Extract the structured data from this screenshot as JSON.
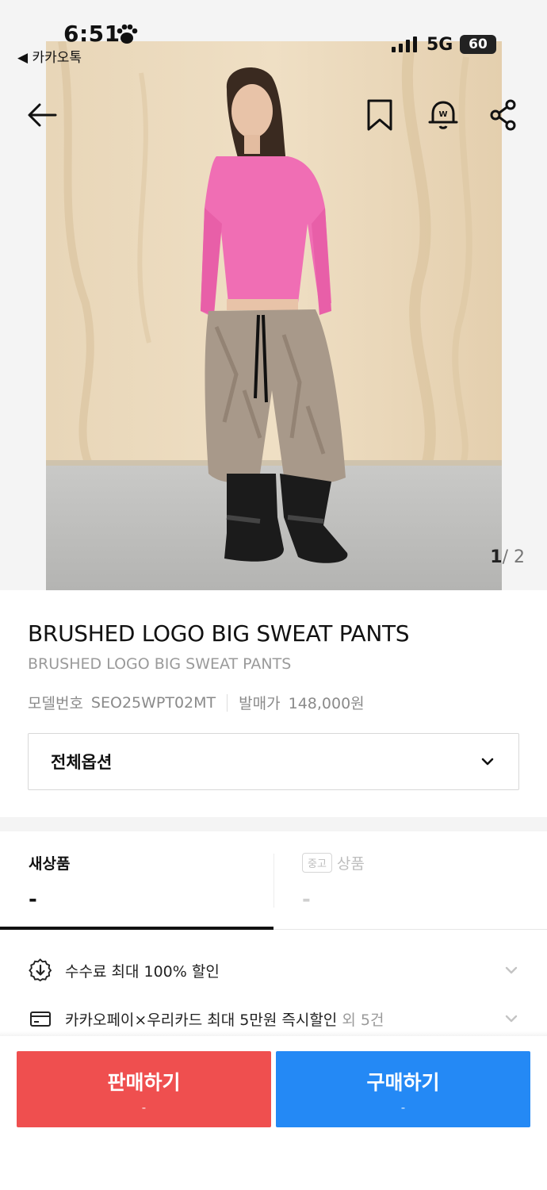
{
  "status_bar": {
    "time": "6:51",
    "back_app": "◀ 카카오톡",
    "network": "5G",
    "battery": "60"
  },
  "nav": {
    "icons": [
      "back-arrow-icon",
      "bookmark-icon",
      "bell-icon",
      "share-icon"
    ]
  },
  "gallery": {
    "current": "1",
    "separator": "/",
    "total": "2"
  },
  "product": {
    "title": "BRUSHED LOGO BIG SWEAT PANTS",
    "subtitle": "BRUSHED LOGO BIG SWEAT PANTS",
    "model_label": "모델번호",
    "model_value": "SEO25WPT02MT",
    "release_label": "발매가",
    "release_value": "148,000원"
  },
  "options": {
    "label": "전체옵션"
  },
  "tabs": [
    {
      "label": "새상품",
      "price": "-"
    },
    {
      "badge": "중고",
      "label": "상품",
      "price": "-"
    }
  ],
  "benefits": [
    {
      "text": "수수료 최대 100% 할인",
      "extra": ""
    },
    {
      "text": "카카오페이×우리카드 최대 5만원 즉시할인",
      "extra": " 외 5건"
    }
  ],
  "actions": {
    "sell_label": "판매하기",
    "sell_sub": "-",
    "buy_label": "구매하기",
    "buy_sub": "-"
  },
  "colors": {
    "sell": "#ef4f4f",
    "buy": "#2489f5",
    "shirt": "#f06eb4"
  }
}
